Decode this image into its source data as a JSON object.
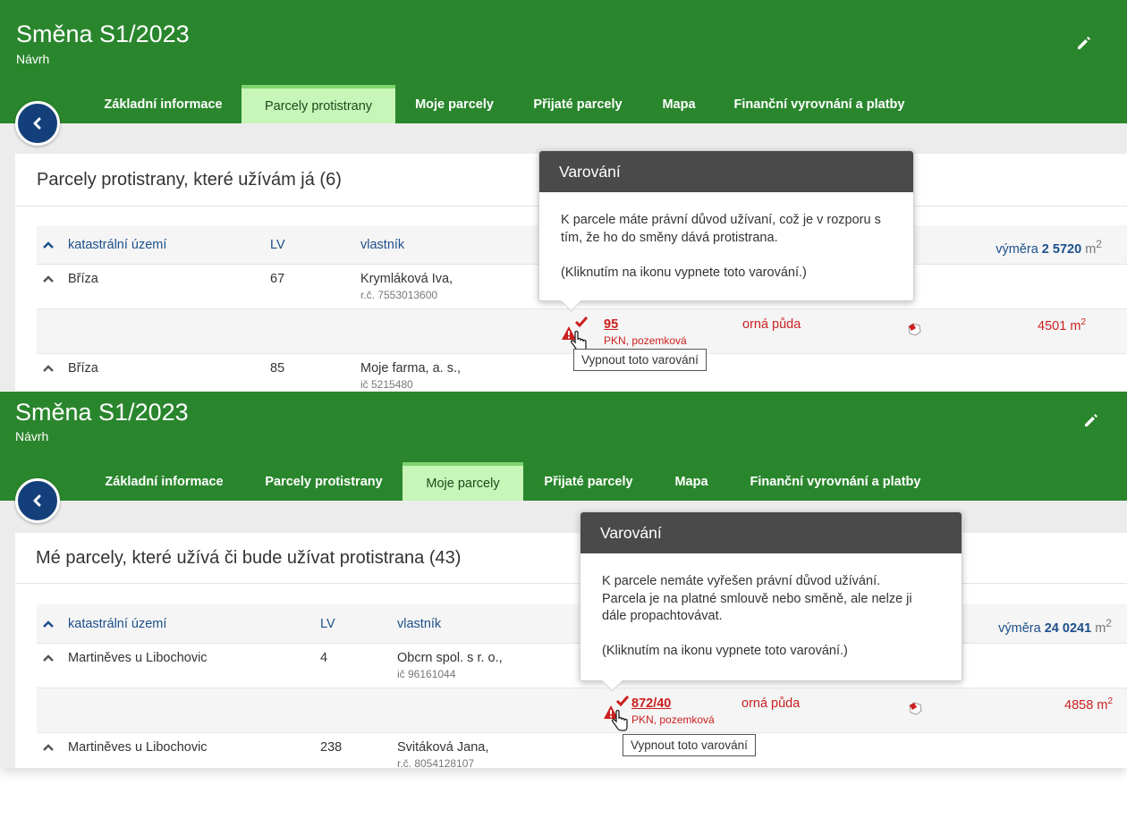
{
  "panel1": {
    "title": "Směna S1/2023",
    "subtitle": "Návrh",
    "tabs": [
      "Základní informace",
      "Parcely protistrany",
      "Moje parcely",
      "Přijaté parcely",
      "Mapa",
      "Finanční vyrovnání a platby"
    ],
    "active_tab": "Parcely protistrany",
    "section_title": "Parcely protistrany, které užívám já (6)",
    "columns": {
      "area": "katastrální území",
      "lv": "LV",
      "owner": "vlastník",
      "total_label": "výměra",
      "total_value": "2 5720",
      "total_unit": "m",
      "total_exp": "2"
    },
    "rows": [
      {
        "area": "Bříza",
        "lv": "67",
        "owner": "Krymláková Iva,",
        "owner_id": "r.č. 7553013600"
      },
      {
        "area": "Bříza",
        "lv": "85",
        "owner": "Moje farma, a. s.,",
        "owner_id": "ič 5215480"
      }
    ],
    "parcel": {
      "number": "95",
      "type": "PKN, pozemková",
      "land_use": "orná půda",
      "area_value": "4501",
      "area_unit": "m",
      "area_exp": "2"
    },
    "popover": {
      "title": "Varování",
      "body": "K parcele máte právní důvod užívaní, což je v rozporu s tím, že ho do směny dává protistrana.\n\n(Kliknutím na ikonu vypnete toto varování.)"
    },
    "tooltip": "Vypnout toto varování"
  },
  "panel2": {
    "title": "Směna S1/2023",
    "subtitle": "Návrh",
    "tabs": [
      "Základní informace",
      "Parcely protistrany",
      "Moje parcely",
      "Přijaté parcely",
      "Mapa",
      "Finanční vyrovnání a platby"
    ],
    "active_tab": "Moje parcely",
    "section_title": "Mé parcely, které užívá či bude užívat protistrana (43)",
    "columns": {
      "area": "katastrální území",
      "lv": "LV",
      "owner": "vlastník",
      "total_label": "výměra",
      "total_value": "24 0241",
      "total_unit": "m",
      "total_exp": "2"
    },
    "rows": [
      {
        "area": "Martiněves u Libochovic",
        "lv": "4",
        "owner": "Obcrn spol. s r. o.,",
        "owner_id": "ič 96161044"
      },
      {
        "area": "Martiněves u Libochovic",
        "lv": "238",
        "owner": "Svitáková Jana,",
        "owner_id": "r.č. 8054128107"
      }
    ],
    "parcel": {
      "number": "872/40",
      "type": "PKN, pozemková",
      "land_use": "orná půda",
      "area_value": "4858",
      "area_unit": "m",
      "area_exp": "2"
    },
    "popover": {
      "title": "Varování",
      "body": "K parcele nemáte vyřešen právní důvod užívání.\nParcela je na platné smlouvě nebo směně, ale nelze ji dále propachtovávat.\n\n(Kliknutím na ikonu vypnete toto varování.)"
    },
    "tooltip": "Vypnout toto varování"
  },
  "colors": {
    "header_green": "#2a862d",
    "active_tab": "#c8f5b8",
    "link_blue": "#1c4f8a",
    "warning_red": "#cc1f1f",
    "back_button": "#13407a"
  },
  "icons": [
    "edit-icon",
    "back-icon",
    "sort-caret-icon",
    "warning-icon",
    "check-icon",
    "hand-cursor-icon",
    "map-icon"
  ]
}
